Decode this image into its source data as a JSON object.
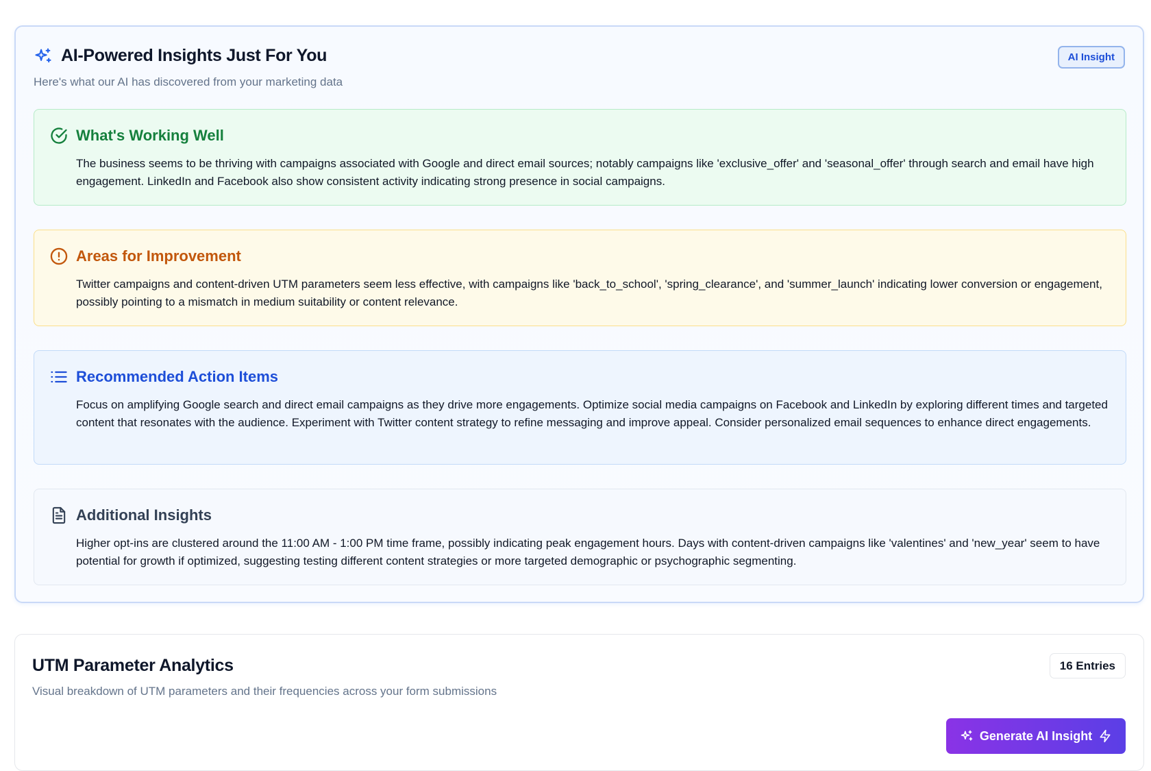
{
  "insights": {
    "title": "AI-Powered Insights Just For You",
    "subtitle": "Here's what our AI has discovered from your marketing data",
    "badge": "AI Insight",
    "accent_color": "#2563eb",
    "sections": [
      {
        "icon": "check-circle-icon",
        "title": "What's Working Well",
        "body": "The business seems to be thriving with campaigns associated with Google and direct email sources; notably campaigns like 'exclusive_offer' and 'seasonal_offer' through search and email have high engagement. LinkedIn and Facebook also show consistent activity indicating strong presence in social campaigns.",
        "color": "#15803d"
      },
      {
        "icon": "alert-circle-icon",
        "title": "Areas for Improvement",
        "body": "Twitter campaigns and content-driven UTM parameters seem less effective, with campaigns like 'back_to_school', 'spring_clearance', and 'summer_launch' indicating lower conversion or engagement, possibly pointing to a mismatch in medium suitability or content relevance.",
        "color": "#c2570c"
      },
      {
        "icon": "list-icon",
        "title": "Recommended Action Items",
        "body": "Focus on amplifying Google search and direct email campaigns as they drive more engagements. Optimize social media campaigns on Facebook and LinkedIn by exploring different times and targeted content that resonates with the audience. Experiment with Twitter content strategy to refine messaging and improve appeal. Consider personalized email sequences to enhance direct engagements.",
        "color": "#1d4ed8"
      },
      {
        "icon": "document-icon",
        "title": "Additional Insights",
        "body": "Higher opt-ins are clustered around the 11:00 AM - 1:00 PM time frame, possibly indicating peak engagement hours. Days with content-driven campaigns like 'valentines' and 'new_year' seem to have potential for growth if optimized, suggesting testing different content strategies or more targeted demographic or psychographic segmenting.",
        "color": "#334155"
      }
    ]
  },
  "utm": {
    "title": "UTM Parameter Analytics",
    "subtitle": "Visual breakdown of UTM parameters and their frequencies across your form submissions",
    "entries_badge": "16 Entries",
    "generate_button": "Generate AI Insight"
  }
}
